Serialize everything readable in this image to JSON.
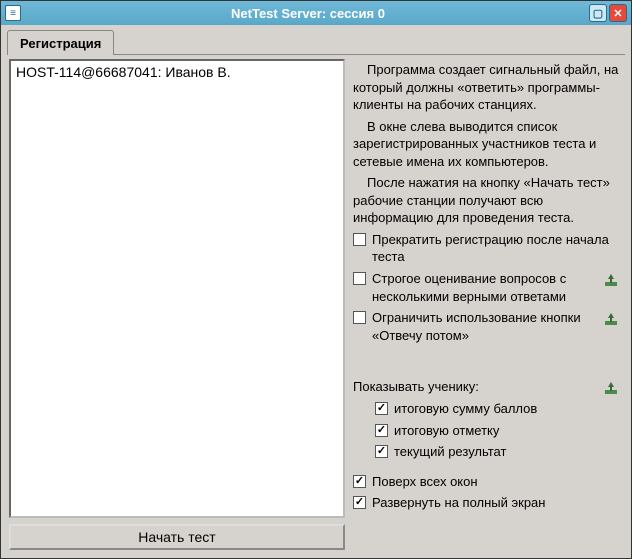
{
  "window": {
    "title": "NetTest Server: сессия 0"
  },
  "tab": {
    "label": "Регистрация"
  },
  "list": {
    "items": [
      "HOST-114@66687041: Иванов В."
    ]
  },
  "start_button": "Начать тест",
  "desc": {
    "p1": "Программа создает сигнальный файл, на который должны «ответить» программы-клиенты на рабочих станциях.",
    "p2": "В окне слева выводится список зарегистрированных участников теста и сетевые имена их компьютеров.",
    "p3": "После нажатия на кнопку «Начать тест» рабочие станции получают всю информацию для проведения теста."
  },
  "opts": {
    "stop_reg": "Прекратить регистрацию после начала теста",
    "strict": "Строгое оценивание вопросов с несколькими верными ответами",
    "limit_later": "Ограничить использование кнопки «Отвечу потом»",
    "show_header": "Показывать ученику:",
    "show_total": "итоговую сумму баллов",
    "show_grade": "итоговую отметку",
    "show_current": "текущий результат",
    "ontop": "Поверх всех окон",
    "fullscreen": "Развернуть на полный экран"
  }
}
